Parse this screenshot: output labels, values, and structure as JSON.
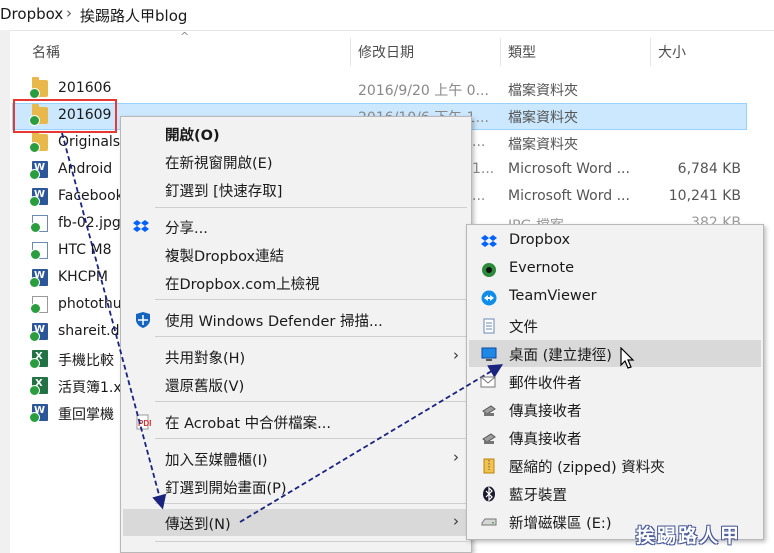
{
  "breadcrumb": {
    "root": "Dropbox",
    "separator": "›",
    "current": "挨踢路人甲blog"
  },
  "columns": {
    "name": "名稱",
    "date": "修改日期",
    "type": "類型",
    "size": "大小"
  },
  "files": [
    {
      "name": "201606",
      "date": "2016/9/20 上午 0...",
      "type": "檔案資料夾",
      "size": "",
      "icon": "folder-icon"
    },
    {
      "name": "201609",
      "date": "2016/10/6 下午 1...",
      "type": "檔案資料夾",
      "size": "",
      "icon": "folder-icon"
    },
    {
      "name": "Originals",
      "date": "...",
      "type": "檔案資料夾",
      "size": "",
      "icon": "folder-icon"
    },
    {
      "name": "Android",
      "date": "1...",
      "type": "Microsoft Word ...",
      "size": "6,784 KB",
      "icon": "word-doc-icon"
    },
    {
      "name": "Facebook",
      "date": "...",
      "type": "Microsoft Word ...",
      "size": "10,241 KB",
      "icon": "word-doc-icon"
    },
    {
      "name": "fb-02.jpg",
      "date": "...",
      "type": "JPG 檔案",
      "size": "382 KB",
      "icon": "image-file-icon"
    },
    {
      "name": "HTC M8",
      "date": "",
      "type": "",
      "size": "",
      "icon": "image-file-icon"
    },
    {
      "name": "KHCPM",
      "date": "",
      "type": "",
      "size": "",
      "icon": "word-doc-icon"
    },
    {
      "name": "photothu",
      "date": "",
      "type": "",
      "size": "",
      "icon": "generic-file-icon"
    },
    {
      "name": "shareit.d",
      "date": "",
      "type": "",
      "size": "",
      "icon": "word-doc-icon"
    },
    {
      "name": "手機比較",
      "date": "",
      "type": "",
      "size": "",
      "icon": "excel-file-icon"
    },
    {
      "name": "活頁簿1.x",
      "date": "",
      "type": "",
      "size": "",
      "icon": "excel-file-icon"
    },
    {
      "name": "重回掌機",
      "date": "",
      "type": "",
      "size": "",
      "icon": "word-doc-icon"
    }
  ],
  "context_menu": {
    "open": "開啟(O)",
    "open_new_window": "在新視窗開啟(E)",
    "pin_quick_access": "釘選到 [快速存取]",
    "share": "分享...",
    "copy_dropbox_link": "複製Dropbox連結",
    "view_on_dropbox": "在Dropbox.com上檢視",
    "scan_defender": "使用 Windows Defender 掃描...",
    "share_with": "共用對象(H)",
    "restore_previous": "還原舊版(V)",
    "acrobat_combine": "在 Acrobat 中合併檔案...",
    "add_to_library": "加入至媒體櫃(I)",
    "pin_to_start": "釘選到開始畫面(P)",
    "send_to": "傳送到(N)"
  },
  "sendto_menu": {
    "items": [
      {
        "label": "Dropbox",
        "icon": "dropbox-icon"
      },
      {
        "label": "Evernote",
        "icon": "evernote-icon"
      },
      {
        "label": "TeamViewer",
        "icon": "teamviewer-icon"
      },
      {
        "label": "文件",
        "icon": "documents-icon"
      },
      {
        "label": "桌面 (建立捷徑)",
        "icon": "desktop-icon"
      },
      {
        "label": "郵件收件者",
        "icon": "mail-icon"
      },
      {
        "label": "傳真接收者",
        "icon": "fax-icon"
      },
      {
        "label": "傳真接收者",
        "icon": "fax-icon"
      },
      {
        "label": "壓縮的 (zipped) 資料夾",
        "icon": "zip-folder-icon"
      },
      {
        "label": "藍牙裝置",
        "icon": "bluetooth-icon"
      },
      {
        "label": "新增磁碟區 (E:)",
        "icon": "drive-icon"
      }
    ],
    "highlighted_index": 4
  },
  "watermark": "挨踢路人甲",
  "colors": {
    "selection": "#cce8ff",
    "menu_bg": "#f2f2f2",
    "highlight": "#d9d9d9",
    "arrow": "#1a237e",
    "red_box": "#e53935"
  }
}
